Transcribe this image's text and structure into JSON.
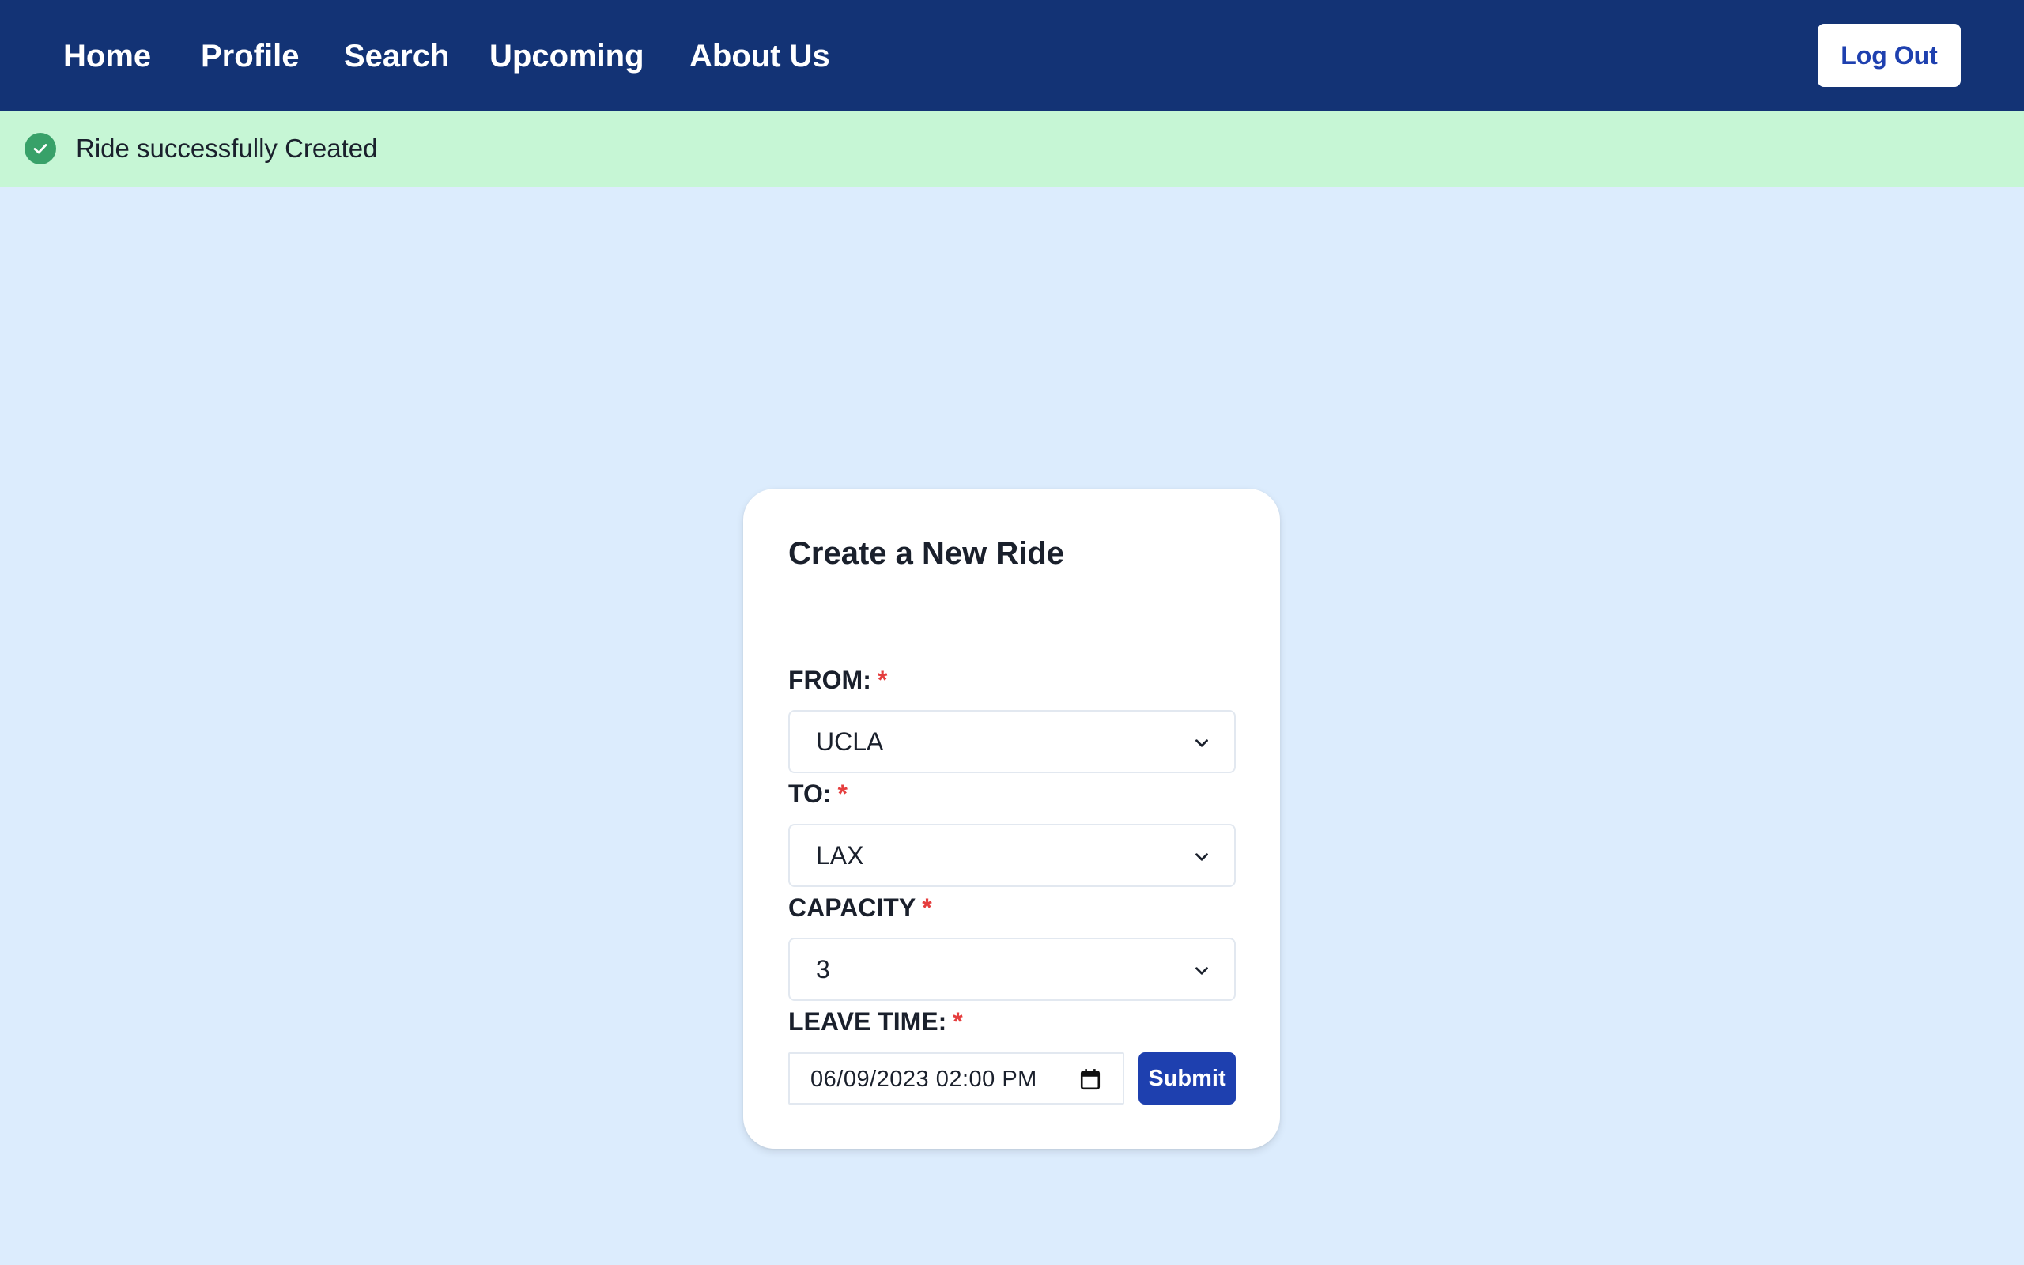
{
  "nav": {
    "links": [
      {
        "label": "Home"
      },
      {
        "label": "Profile"
      },
      {
        "label": "Search"
      },
      {
        "label": "Upcoming"
      },
      {
        "label": "About Us"
      }
    ],
    "logout_label": "Log Out"
  },
  "alert": {
    "status": "success",
    "icon": "check-circle-icon",
    "message": "Ride successfully Created"
  },
  "form": {
    "title": "Create a New Ride",
    "required_marker": "*",
    "from": {
      "label": "FROM:",
      "value": "UCLA"
    },
    "to": {
      "label": "TO:",
      "value": "LAX"
    },
    "capacity": {
      "label": "CAPACITY",
      "value": "3"
    },
    "leave_time": {
      "label": "LEAVE TIME:",
      "value": "06/09/2023  02:00  PM"
    },
    "submit_label": "Submit"
  },
  "colors": {
    "nav_background": "#133375",
    "page_background": "#dcecfd",
    "alert_background": "#c6f6d5",
    "alert_icon": "#38a169",
    "primary_button": "#1e40af",
    "required_marker": "#e53e3e"
  }
}
